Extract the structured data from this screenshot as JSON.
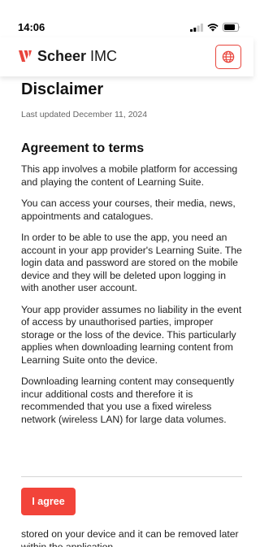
{
  "status_bar": {
    "time": "14:06",
    "icons": [
      "signal-icon",
      "wifi-icon",
      "battery-icon"
    ]
  },
  "header": {
    "brand": "Scheer",
    "brand_suffix": "IMC",
    "accent_color": "#e8453c",
    "language_icon": "globe-icon"
  },
  "page": {
    "title": "Disclaimer",
    "last_updated": "Last updated December 11, 2024",
    "section_heading": "Agreement to terms",
    "paragraphs": [
      "This app involves a mobile platform for accessing and playing the content of Learning Suite.",
      "You can access your courses, their media, news, appointments and catalogues.",
      "In order to be able to use the app, you need an account in your app provider's Learning Suite. The login data and password are stored on the mobile device and they will be deleted upon logging in with another user account.",
      "Your app provider assumes no liability in the event of access by unauthorised parties, improper storage or the loss of the device. This particularly applies when downloading learning content from Learning Suite onto the device.",
      "Downloading learning content may consequently incur additional costs and therefore it is recommended that you use a fixed wireless network (wireless LAN) for large data volumes."
    ],
    "agree_button": "I agree",
    "after_text": "stored on your device and it can be removed later within the application"
  }
}
